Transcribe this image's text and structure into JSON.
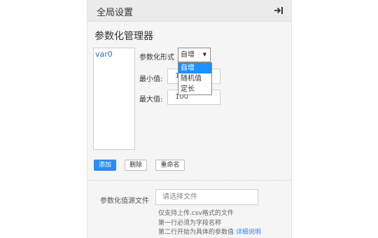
{
  "header": {
    "title": "全局设置",
    "collapse_icon": "collapse-right-icon"
  },
  "section": {
    "title": "参数化管理器"
  },
  "variables": [
    {
      "name": "var0"
    }
  ],
  "form": {
    "type_label": "参数化形式",
    "selected_value": "自增",
    "options": [
      "自增",
      "随机值",
      "定长"
    ],
    "min_label": "最小值:",
    "min_value": "1",
    "max_label": "最大值:",
    "max_value": "100"
  },
  "buttons": {
    "add": "添加",
    "delete": "删除",
    "rename": "重命名"
  },
  "source": {
    "label": "参数化值源文件",
    "placeholder": "请选择文件",
    "hints": [
      "仅支持上传.csv格式的文件",
      "第一行必须为字段名称",
      "第二行开始为具体的参数值"
    ],
    "detail_link": "详细说明"
  },
  "colors": {
    "accent": "#2d8cf0",
    "selected_option": "#1e90ff",
    "link": "#2f6fb0"
  }
}
